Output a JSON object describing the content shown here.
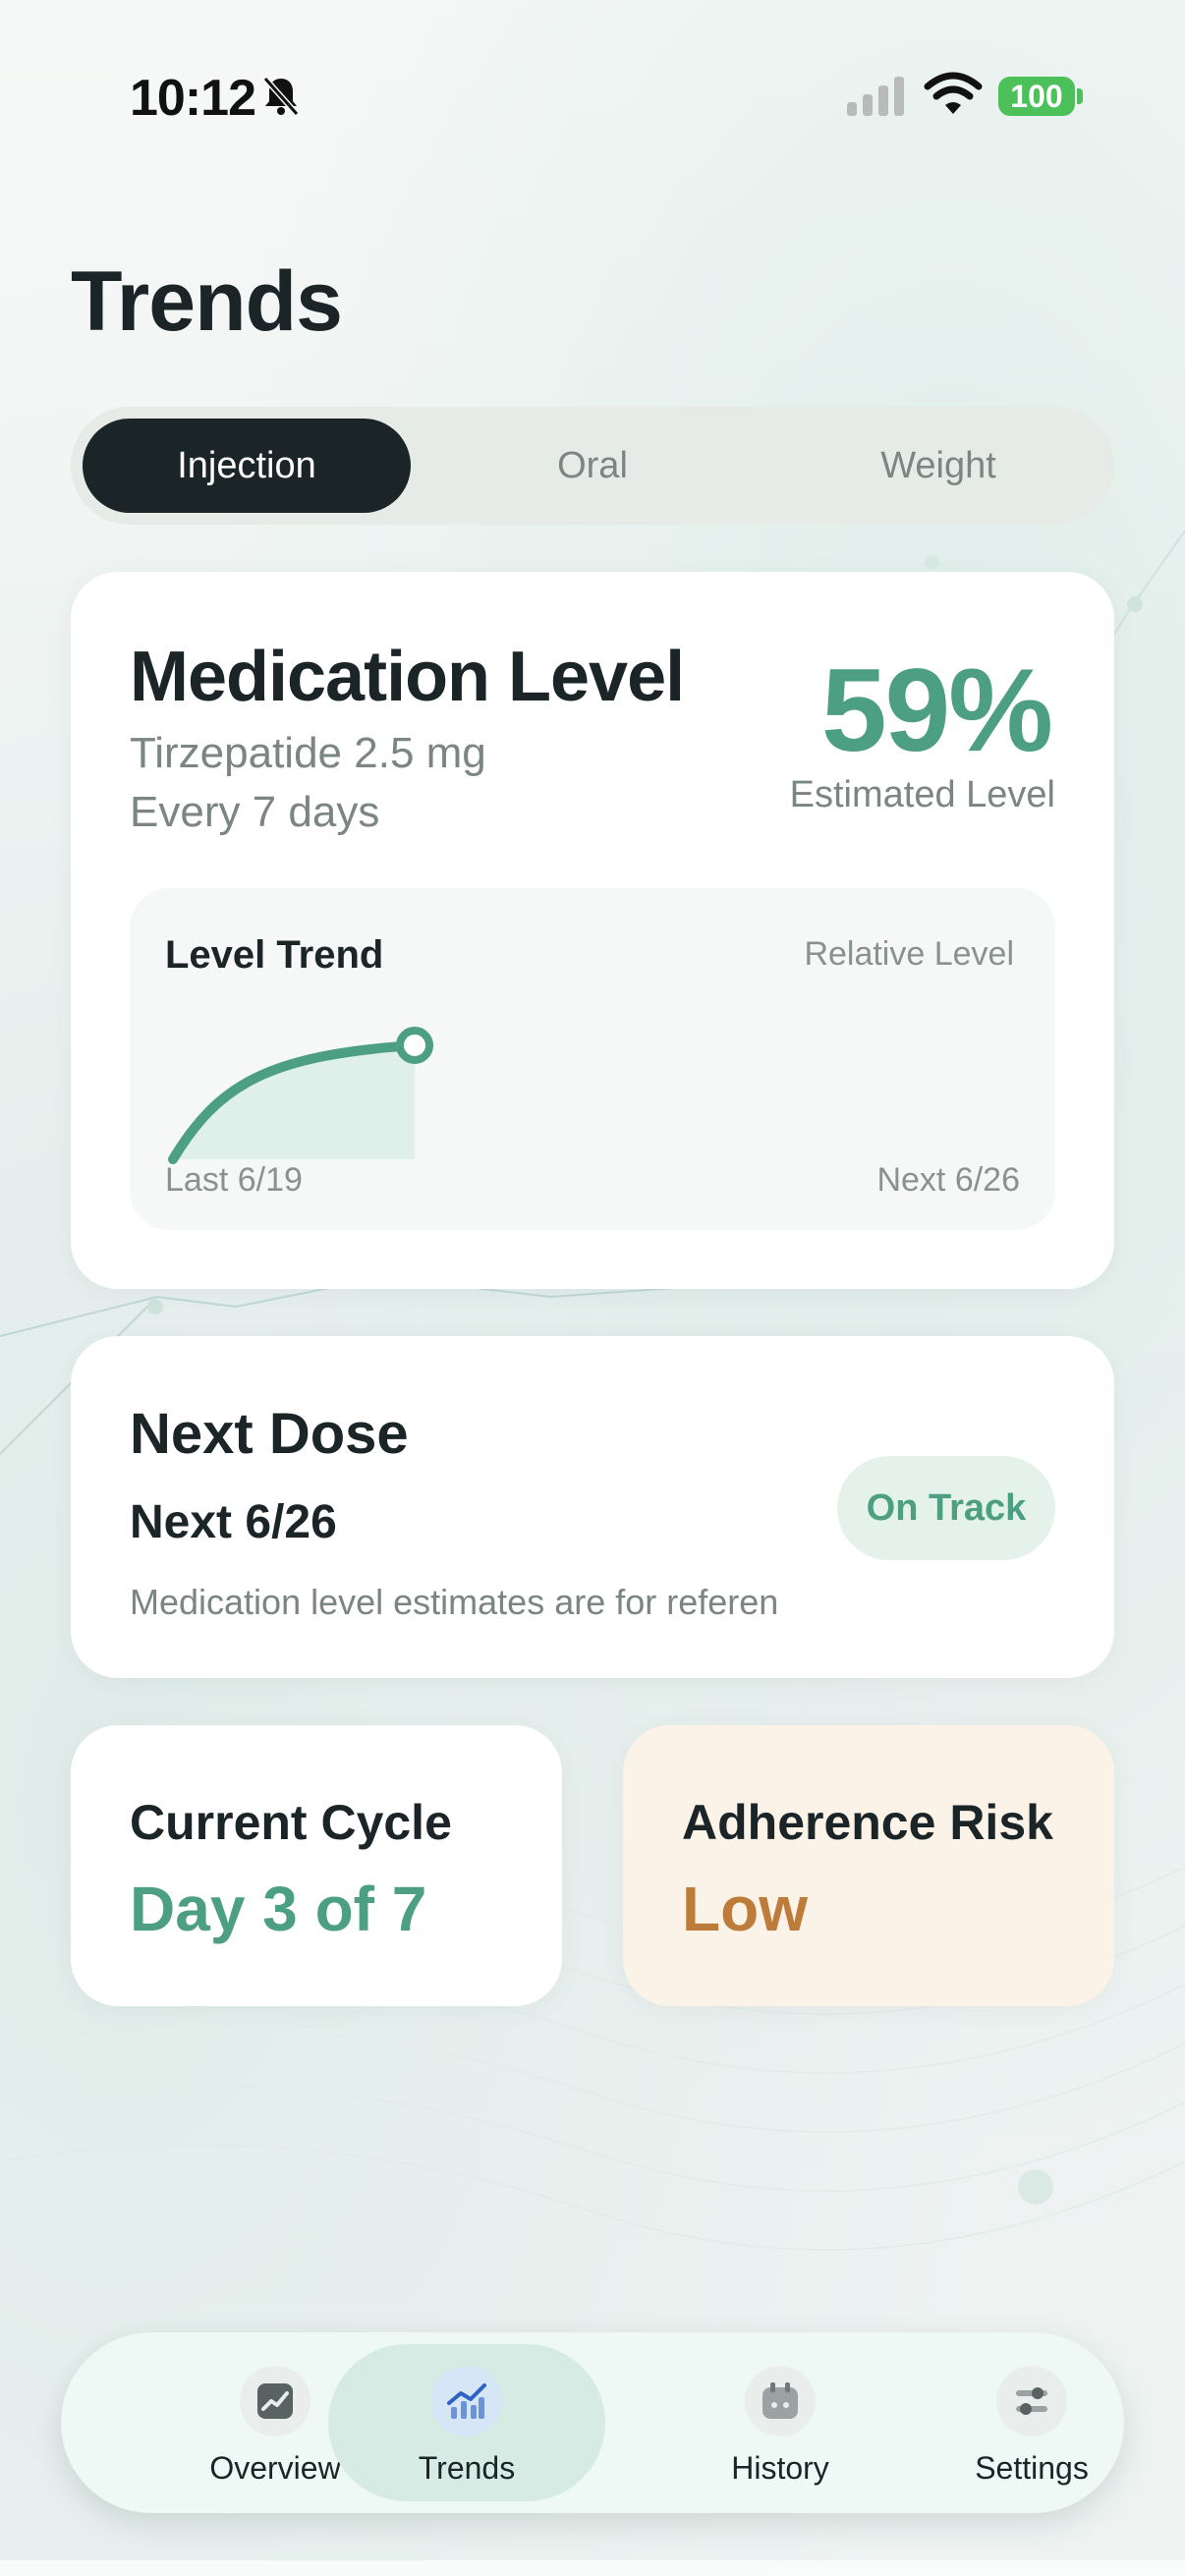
{
  "status_bar": {
    "time": "10:12",
    "battery": "100",
    "icons": [
      "bell-slash-icon",
      "cellular-signal-icon",
      "wifi-icon",
      "battery-icon"
    ],
    "battery_color": "#4cc15a"
  },
  "header": {
    "title": "Trends"
  },
  "segments": {
    "items": [
      {
        "label": "Injection",
        "active": true
      },
      {
        "label": "Oral",
        "active": false
      },
      {
        "label": "Weight",
        "active": false
      }
    ]
  },
  "medication": {
    "title": "Medication Level",
    "drug": "Tirzepatide 2.5 mg",
    "frequency": "Every 7 days",
    "percent": "59%",
    "percent_label": "Estimated Level",
    "accent": "#4c9f82",
    "trend": {
      "title": "Level Trend",
      "scale_label": "Relative Level",
      "start_label": "Last 6/19",
      "end_label": "Next 6/26"
    }
  },
  "next_dose": {
    "title": "Next Dose",
    "date": "Next 6/26",
    "note": "Medication level estimates are for referen",
    "badge": "On Track"
  },
  "cycle": {
    "label": "Current Cycle",
    "value": "Day 3 of 7"
  },
  "risk": {
    "label": "Adherence Risk",
    "value": "Low",
    "color": "#bd7c3a"
  },
  "tab_bar": {
    "items": [
      {
        "label": "Overview",
        "icon": "chart-card-icon",
        "active": false
      },
      {
        "label": "Trends",
        "icon": "trend-chart-icon",
        "active": true
      },
      {
        "label": "History",
        "icon": "calendar-icon",
        "active": false
      },
      {
        "label": "Settings",
        "icon": "sliders-icon",
        "active": false
      }
    ]
  }
}
